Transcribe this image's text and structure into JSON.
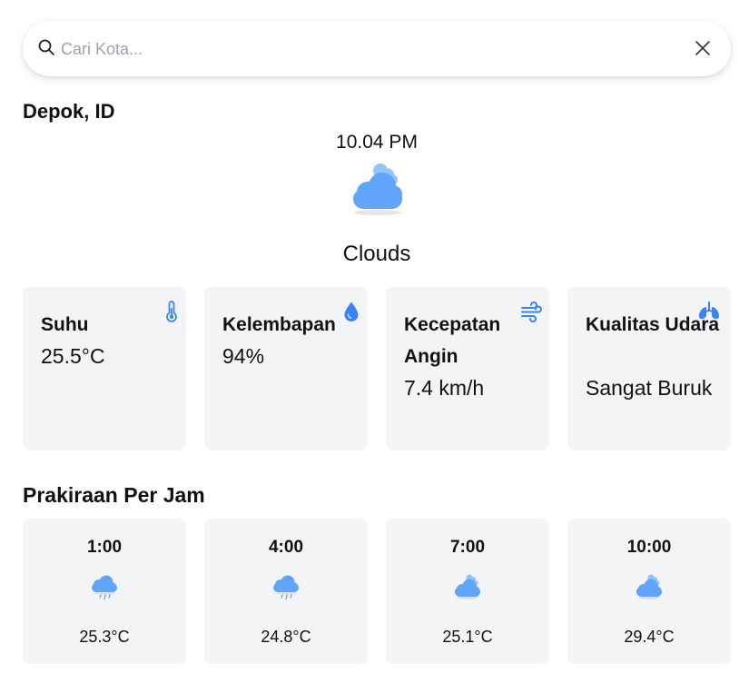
{
  "search": {
    "placeholder": "Cari Kota...",
    "value": ""
  },
  "location": "Depok, ID",
  "current": {
    "time": "10.04 PM",
    "icon": "cloud-icon",
    "condition": "Clouds"
  },
  "stats": [
    {
      "title": "Suhu",
      "value": "25.5°C",
      "icon": "thermometer-icon"
    },
    {
      "title": "Kelembapan",
      "value": "94%",
      "icon": "water-drop-icon"
    },
    {
      "title": "Kecepatan Angin",
      "value": "7.4 km/h",
      "icon": "wind-icon"
    },
    {
      "title": "Kualitas Udara",
      "value": "Sangat Buruk",
      "icon": "lungs-icon"
    }
  ],
  "hourly": {
    "title": "Prakiraan Per Jam",
    "items": [
      {
        "time": "1:00",
        "temp": "25.3°C",
        "icon": "rain-cloud-icon"
      },
      {
        "time": "4:00",
        "temp": "24.8°C",
        "icon": "rain-cloud-icon"
      },
      {
        "time": "7:00",
        "temp": "25.1°C",
        "icon": "cloud-icon"
      },
      {
        "time": "10:00",
        "temp": "29.4°C",
        "icon": "cloud-icon"
      }
    ]
  },
  "colors": {
    "accent": "#3b82f6",
    "cloud_main": "#60a5fa",
    "cloud_back": "#93c5fd",
    "card_bg": "#f3f4f6"
  }
}
